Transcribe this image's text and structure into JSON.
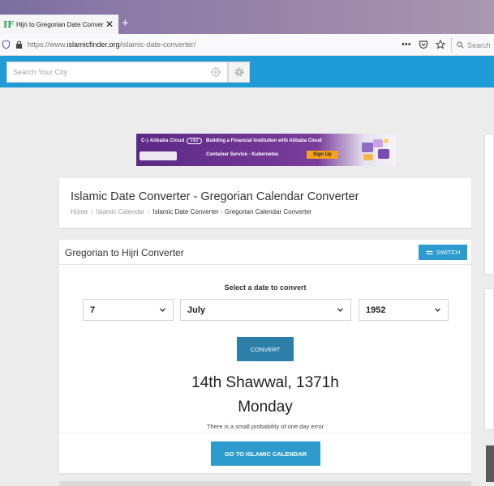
{
  "browser": {
    "tab_logo": "IF",
    "tab_title": "Hijri to Gregorian Date Conver",
    "tab_close": "✕",
    "new_tab": "+",
    "url_prefix": "https://www.",
    "url_domain": "islamicfinder.org",
    "url_path": "/islamic-date-converter/",
    "menu_dots": "•••",
    "search_placeholder": "Search"
  },
  "site": {
    "search_placeholder": "Search Your City",
    "accent_color": "#1f9bd7"
  },
  "ad": {
    "brand": "C-) Alibaba Cloud",
    "partner": "intel",
    "line1": "Building a Financial Institution with Alibaba Cloud",
    "line2": "Container Service - Kubernetes",
    "cta": "Sign Up"
  },
  "header": {
    "title": "Islamic Date Converter - Gregorian Calendar Converter",
    "breadcrumb": [
      "Home",
      "Islamic Calendar",
      "Islamic Date Converter - Gregorian Calendar Converter"
    ]
  },
  "converter": {
    "title": "Gregorian to Hijri Converter",
    "switch_label": "SWITCH",
    "select_label": "Select a date to convert",
    "day": "7",
    "month": "July",
    "year": "1952",
    "convert_label": "CONVERT",
    "result_date": "14th Shawwal, 1371h",
    "result_day": "Monday",
    "note": "There is a small probability of one day error",
    "calendar_button": "GO TO ISLAMIC CALENDAR"
  }
}
